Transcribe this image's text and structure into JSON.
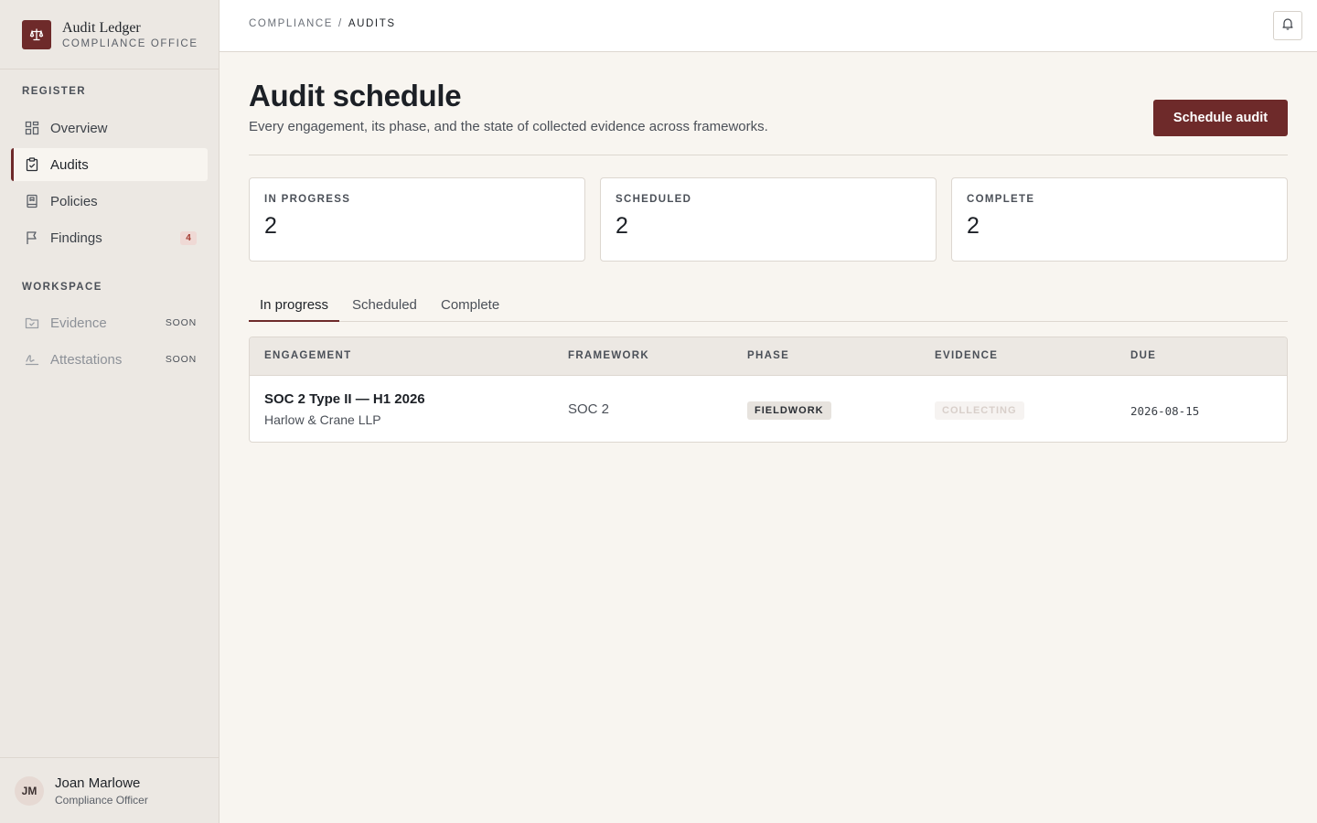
{
  "brand": {
    "name": "Audit Ledger",
    "subtitle": "COMPLIANCE OFFICE",
    "logo_icon": "scales-icon"
  },
  "sidebar": {
    "register_label": "REGISTER",
    "workspace_label": "WORKSPACE",
    "items": [
      {
        "label": "Overview",
        "icon": "grid-icon"
      },
      {
        "label": "Audits",
        "icon": "clipboard-check-icon",
        "active": true
      },
      {
        "label": "Policies",
        "icon": "book-icon"
      },
      {
        "label": "Findings",
        "icon": "flag-icon",
        "badge": "4"
      }
    ],
    "workspace_items": [
      {
        "label": "Evidence",
        "icon": "folder-check-icon",
        "tag": "SOON"
      },
      {
        "label": "Attestations",
        "icon": "signature-icon",
        "tag": "SOON"
      }
    ]
  },
  "user": {
    "initials": "JM",
    "name": "Joan Marlowe",
    "role": "Compliance Officer"
  },
  "breadcrumb": {
    "root": "COMPLIANCE",
    "separator": "/",
    "current": "AUDITS"
  },
  "page": {
    "title": "Audit schedule",
    "subtitle": "Every engagement, its phase, and the state of collected evidence across frameworks.",
    "primary_action": "Schedule audit"
  },
  "stats": [
    {
      "label": "IN PROGRESS",
      "value": "2"
    },
    {
      "label": "SCHEDULED",
      "value": "2"
    },
    {
      "label": "COMPLETE",
      "value": "2"
    }
  ],
  "tabs": [
    {
      "label": "In progress",
      "active": true
    },
    {
      "label": "Scheduled"
    },
    {
      "label": "Complete"
    }
  ],
  "table": {
    "columns": [
      "ENGAGEMENT",
      "FRAMEWORK",
      "PHASE",
      "EVIDENCE",
      "DUE"
    ],
    "rows": [
      {
        "engagement": "SOC 2 Type II — H1 2026",
        "auditor": "Harlow & Crane LLP",
        "framework": "SOC 2",
        "phase": "FIELDWORK",
        "evidence": "COLLECTING",
        "due": "2026-08-15"
      }
    ]
  },
  "colors": {
    "accent": "#6e2a2a",
    "sidebar_bg": "#ece8e3",
    "page_bg": "#f8f5f0",
    "badge_bg": "#efd9d5",
    "badge_text": "#a33a30"
  }
}
